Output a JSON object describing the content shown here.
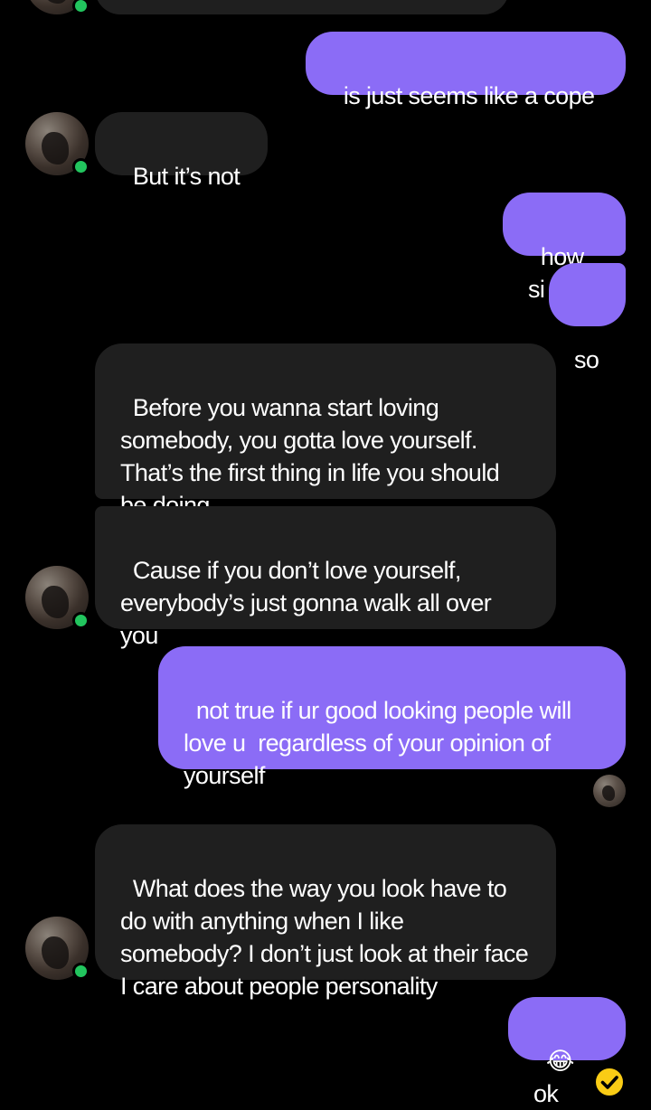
{
  "conversation": {
    "messages": [
      {
        "id": "m1",
        "side": "out",
        "text": "is just seems like a cope"
      },
      {
        "id": "m2",
        "side": "in",
        "text": "But it’s not"
      },
      {
        "id": "m3",
        "side": "out",
        "text": "how si"
      },
      {
        "id": "m4",
        "side": "out",
        "text": "so"
      },
      {
        "id": "m5",
        "side": "in",
        "text": "Before you wanna start loving somebody, you gotta love yourself. That’s the first thing in life you should be doing."
      },
      {
        "id": "m6",
        "side": "in",
        "text": "Cause if you don’t love yourself, everybody’s just gonna walk all over you"
      },
      {
        "id": "m7",
        "side": "out",
        "text": "not true if ur good looking people will love u  regardless of your opinion of yourself"
      },
      {
        "id": "m8",
        "side": "in",
        "text": "What does the way you look have to do with anything when I like somebody? I don’t just look at their face I care about people personality"
      },
      {
        "id": "m9",
        "side": "out",
        "text": "😂 ok"
      }
    ]
  },
  "colors": {
    "background": "#000000",
    "incoming_bubble": "#1f1f1f",
    "outgoing_bubble": "#8b6cf6",
    "online_indicator": "#22c55e",
    "delivered_check": "#facc15"
  },
  "icons": {
    "online": "green-dot",
    "delivered": "check-circle-icon"
  }
}
